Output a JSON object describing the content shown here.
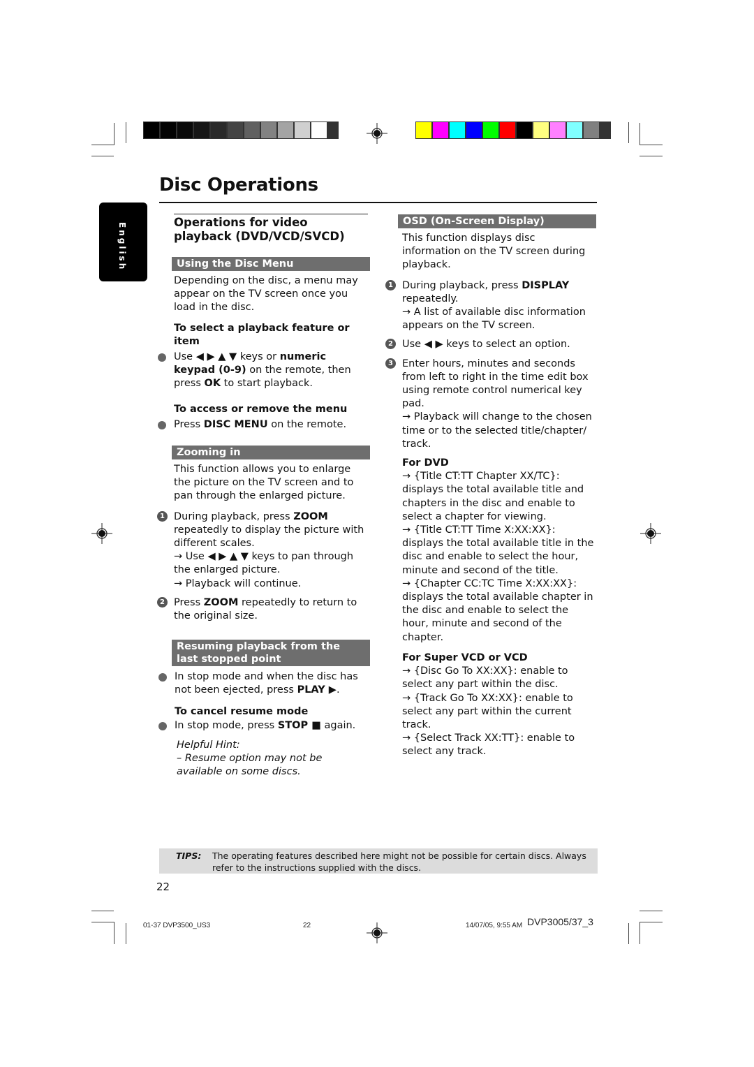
{
  "page": {
    "title": "Disc Operations",
    "language_tab": "English",
    "page_number": "22"
  },
  "print_marks": {
    "grayscale_swatches": [
      "#000000",
      "#030303",
      "#0a0a0a",
      "#161616",
      "#2a2a2a",
      "#444444",
      "#606060",
      "#828282",
      "#a4a4a4",
      "#d0d0d0",
      "#ffffff"
    ],
    "color_swatches": [
      "#ffff00",
      "#ff00ff",
      "#00ffff",
      "#0000ff",
      "#00ff00",
      "#ff0000",
      "#000000",
      "#ffff80",
      "#ff80ff",
      "#80ffff",
      "#808080"
    ]
  },
  "left_column": {
    "heading": "Operations for video playback (DVD/VCD/SVCD)",
    "disc_menu": {
      "bar": "Using the Disc Menu",
      "intro": "Depending on the disc, a menu may appear on the TV screen once you load in the disc.",
      "select_sub": "To select a playback feature or item",
      "select_text_1": "Use ◀ ▶ ▲ ▼ keys or ",
      "select_bold_1": "numeric keypad (0-9)",
      "select_text_2": " on the remote, then press ",
      "select_bold_2": "OK",
      "select_text_3": " to start playback.",
      "access_sub": "To access or remove the menu",
      "access_text_1": "Press ",
      "access_bold": "DISC MENU",
      "access_text_2": " on the remote."
    },
    "zooming": {
      "bar": "Zooming in",
      "intro": "This function allows you to enlarge the picture on the TV screen and to pan through the enlarged picture.",
      "step1_num": "1",
      "step1_text_1": "During playback, press ",
      "step1_bold": "ZOOM",
      "step1_text_2": " repeatedly to display the picture with different scales.",
      "step1_arrow_1": "→ Use ◀ ▶ ▲ ▼ keys to pan through the enlarged picture.",
      "step1_arrow_2": "→ Playback will continue.",
      "step2_num": "2",
      "step2_text_1": "Press ",
      "step2_bold": "ZOOM",
      "step2_text_2": " repeatedly to return to the original size."
    },
    "resume": {
      "bar": "Resuming playback from the last stopped point",
      "bullet_text_1": "In stop mode and when the disc has not been ejected, press ",
      "bullet_bold": "PLAY ▶",
      "bullet_text_2": ".",
      "cancel_sub": "To cancel resume mode",
      "cancel_text_1": "In stop mode, press ",
      "cancel_bold": "STOP ■",
      "cancel_text_2": " again.",
      "hint_label": "Helpful Hint:",
      "hint_text": "–    Resume option may not be available on some discs."
    }
  },
  "right_column": {
    "osd": {
      "bar": "OSD (On-Screen Display)",
      "intro": "This function displays disc information on the TV screen during playback.",
      "step1_num": "1",
      "step1_text_1": "During playback, press ",
      "step1_bold": "DISPLAY",
      "step1_text_2": " repeatedly.",
      "step1_arrow": "→ A list of available disc information appears on the TV screen.",
      "step2_num": "2",
      "step2_text": "Use ◀ ▶ keys to select an option.",
      "step3_num": "3",
      "step3_text": "Enter hours, minutes and seconds from left to right in the time edit box using remote control numerical key pad.",
      "step3_arrow": "→ Playback will change to the chosen time or to the selected title/chapter/ track."
    },
    "for_dvd": {
      "sub": "For DVD",
      "items": [
        "→ {Title CT:TT Chapter XX/TC}: displays the total available title and chapters in the disc and enable to select a chapter for viewing.",
        "→ {Title CT:TT Time X:XX:XX}: displays the total available title in the disc and enable to select the hour, minute and second of the title.",
        "→ {Chapter CC:TC Time X:XX:XX}: displays the total available chapter in the disc and enable to select the hour, minute and second of the chapter."
      ]
    },
    "for_vcd": {
      "sub": "For Super VCD or VCD",
      "items": [
        "→ {Disc Go To XX:XX}: enable to select any part within the disc.",
        "→ {Track Go To XX:XX}: enable to select any part within the current track.",
        "→ {Select Track XX:TT}: enable to select any track."
      ]
    }
  },
  "tips": {
    "label": "TIPS:",
    "text": "The operating features described here might not be possible for certain discs.  Always refer to the instructions supplied with the discs."
  },
  "slug": {
    "file": "01-37 DVP3500_US3",
    "page": "22",
    "date": "14/07/05, 9:55 AM",
    "model": "DVP3005/37_3"
  }
}
